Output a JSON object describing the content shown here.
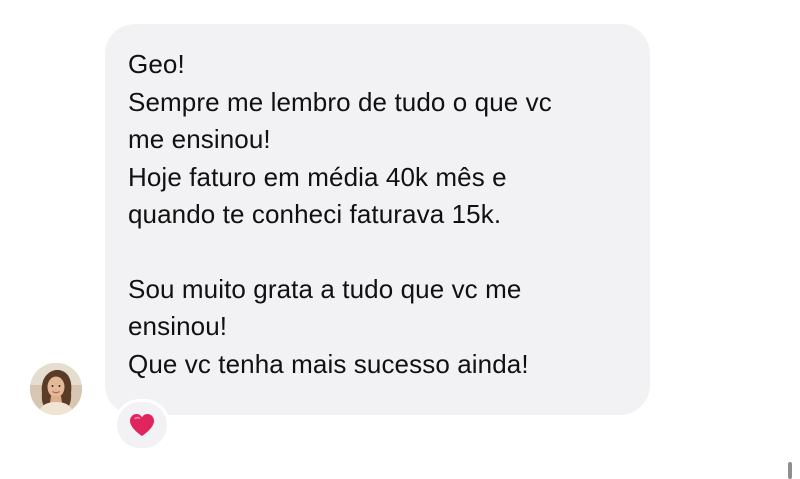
{
  "message": {
    "lines": [
      "Geo!",
      "Sempre me lembro de tudo o que vc",
      "me ensinou!",
      "Hoje faturo em média 40k mês e",
      "quando te conheci faturava 15k.",
      "Sou muito grata a tudo que vc me",
      "ensinou!",
      "Que vc tenha mais sucesso ainda!"
    ]
  },
  "reaction": {
    "icon": "red-heart-icon",
    "color": "#e0245e"
  },
  "colors": {
    "bubble": "#f2f2f4",
    "text": "#111111"
  }
}
